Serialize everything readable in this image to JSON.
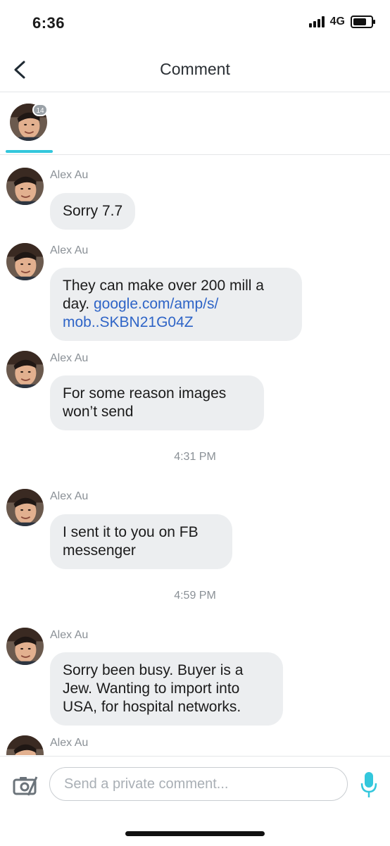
{
  "status_bar": {
    "time": "6:36",
    "network": "4G",
    "battery_level": 0.75
  },
  "nav": {
    "title": "Comment"
  },
  "tabs": [
    {
      "badge": "14"
    }
  ],
  "messages": [
    {
      "sender": "Alex Au",
      "text": "Sorry 7.7"
    },
    {
      "sender": "Alex Au",
      "text": "They can make over 200 mill a day. ",
      "link": "google.com/amp/s/ mob..SKBN21G04Z"
    },
    {
      "sender": "Alex Au",
      "text": "For some reason images won’t send"
    },
    {
      "sender": "Alex Au",
      "text": "I sent it to you on FB messenger"
    },
    {
      "sender": "Alex Au",
      "text": "Sorry been busy. Buyer is a Jew. Wanting to import into USA, for hospital networks."
    },
    {
      "sender": "Alex Au"
    }
  ],
  "timestamps": [
    "4:31 PM",
    "4:59 PM"
  ],
  "composer": {
    "placeholder": "Send a private comment..."
  },
  "colors": {
    "accent": "#33c7dc",
    "bubble": "#eceef0",
    "link": "#2e64c7"
  },
  "icons": {
    "back": "chevron-left-icon",
    "camera": "camera-icon",
    "mic": "microphone-icon"
  }
}
